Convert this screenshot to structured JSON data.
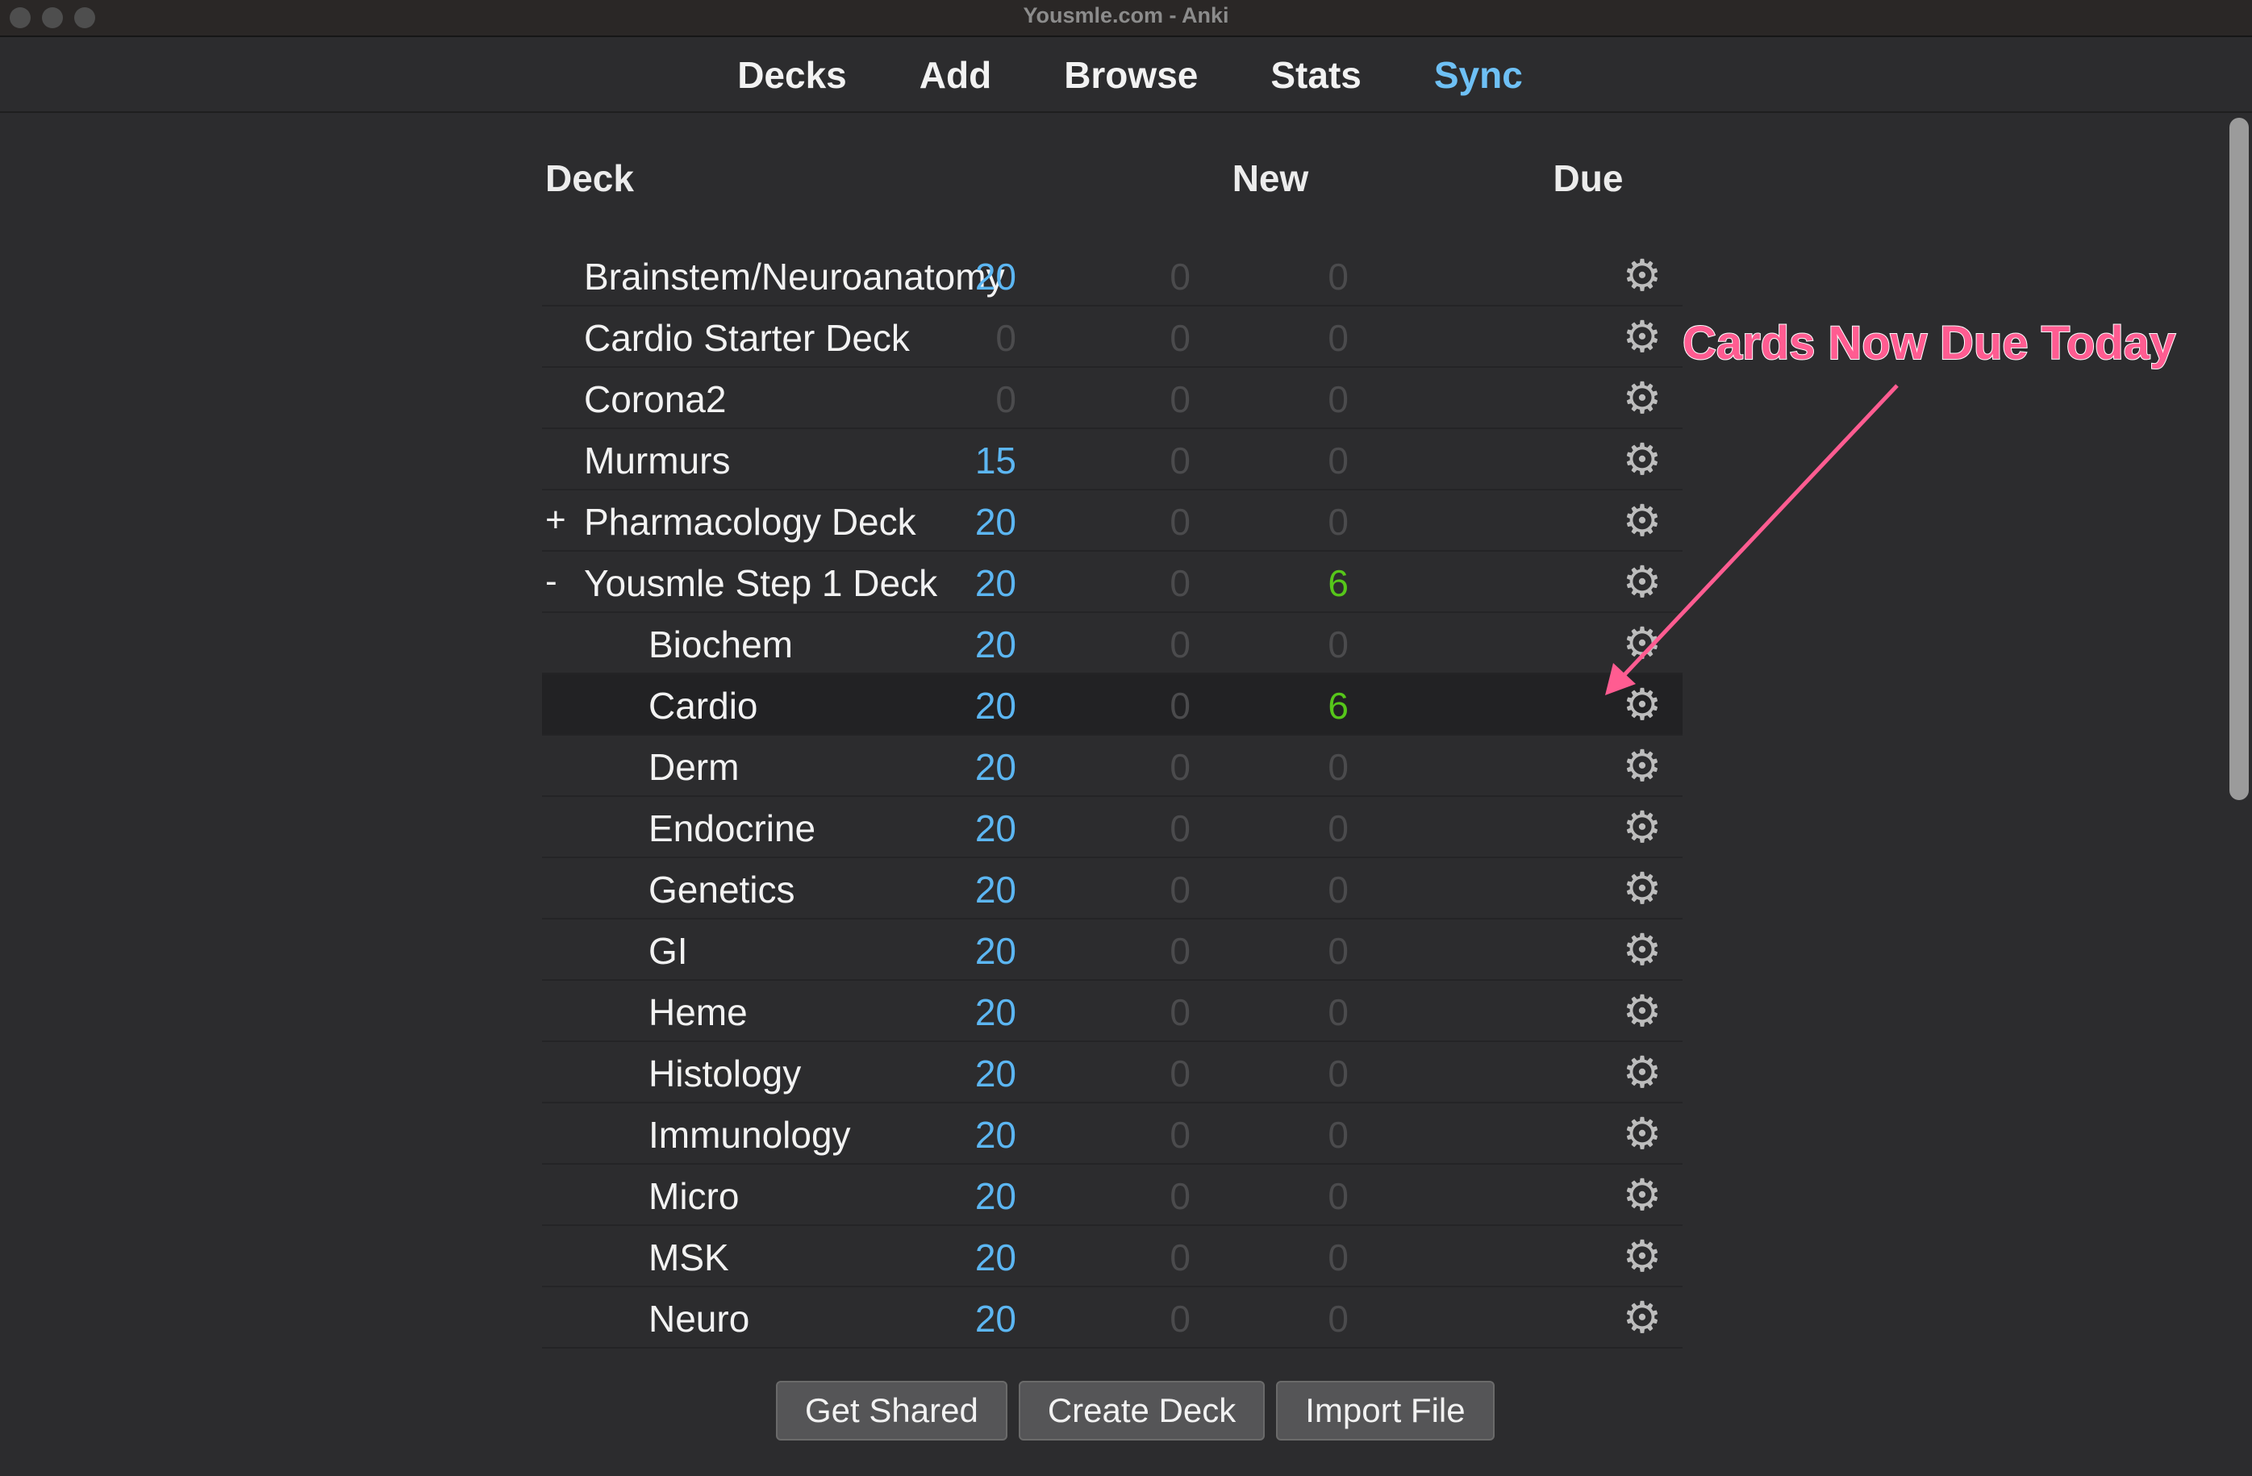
{
  "window": {
    "title": "Yousmle.com - Anki"
  },
  "toolbar": {
    "decks": "Decks",
    "add": "Add",
    "browse": "Browse",
    "stats": "Stats",
    "sync": "Sync"
  },
  "table": {
    "headers": {
      "deck": "Deck",
      "new": "New",
      "due": "Due"
    },
    "rows": [
      {
        "expander": "",
        "name": "Brainstem/Neuroanatomy",
        "new": "20",
        "learn": "0",
        "due": "0",
        "level": 0
      },
      {
        "expander": "",
        "name": "Cardio Starter Deck",
        "new": "0",
        "learn": "0",
        "due": "0",
        "level": 0
      },
      {
        "expander": "",
        "name": "Corona2",
        "new": "0",
        "learn": "0",
        "due": "0",
        "level": 0
      },
      {
        "expander": "",
        "name": "Murmurs",
        "new": "15",
        "learn": "0",
        "due": "0",
        "level": 0
      },
      {
        "expander": "+",
        "name": "Pharmacology Deck",
        "new": "20",
        "learn": "0",
        "due": "0",
        "level": 0
      },
      {
        "expander": "-",
        "name": "Yousmle Step 1 Deck",
        "new": "20",
        "learn": "0",
        "due": "6",
        "level": 0
      },
      {
        "expander": "",
        "name": "Biochem",
        "new": "20",
        "learn": "0",
        "due": "0",
        "level": 1
      },
      {
        "expander": "",
        "name": "Cardio",
        "new": "20",
        "learn": "0",
        "due": "6",
        "level": 1,
        "selected": true
      },
      {
        "expander": "",
        "name": "Derm",
        "new": "20",
        "learn": "0",
        "due": "0",
        "level": 1
      },
      {
        "expander": "",
        "name": "Endocrine",
        "new": "20",
        "learn": "0",
        "due": "0",
        "level": 1
      },
      {
        "expander": "",
        "name": "Genetics",
        "new": "20",
        "learn": "0",
        "due": "0",
        "level": 1
      },
      {
        "expander": "",
        "name": "GI",
        "new": "20",
        "learn": "0",
        "due": "0",
        "level": 1
      },
      {
        "expander": "",
        "name": "Heme",
        "new": "20",
        "learn": "0",
        "due": "0",
        "level": 1
      },
      {
        "expander": "",
        "name": "Histology",
        "new": "20",
        "learn": "0",
        "due": "0",
        "level": 1
      },
      {
        "expander": "",
        "name": "Immunology",
        "new": "20",
        "learn": "0",
        "due": "0",
        "level": 1
      },
      {
        "expander": "",
        "name": "Micro",
        "new": "20",
        "learn": "0",
        "due": "0",
        "level": 1
      },
      {
        "expander": "",
        "name": "MSK",
        "new": "20",
        "learn": "0",
        "due": "0",
        "level": 1
      },
      {
        "expander": "",
        "name": "Neuro",
        "new": "20",
        "learn": "0",
        "due": "0",
        "level": 1
      }
    ]
  },
  "buttons": {
    "get_shared": "Get Shared",
    "create_deck": "Create Deck",
    "import_file": "Import File"
  },
  "annotation": {
    "text": "Cards Now Due Today"
  },
  "colors": {
    "new_count": "#5cb6f2",
    "due_count": "#56c61a",
    "zero_count": "#4b4b4d",
    "sync_link": "#6ec0f5",
    "annotation": "#ff5c91"
  },
  "icons": {
    "deck_options": "gear-icon"
  }
}
